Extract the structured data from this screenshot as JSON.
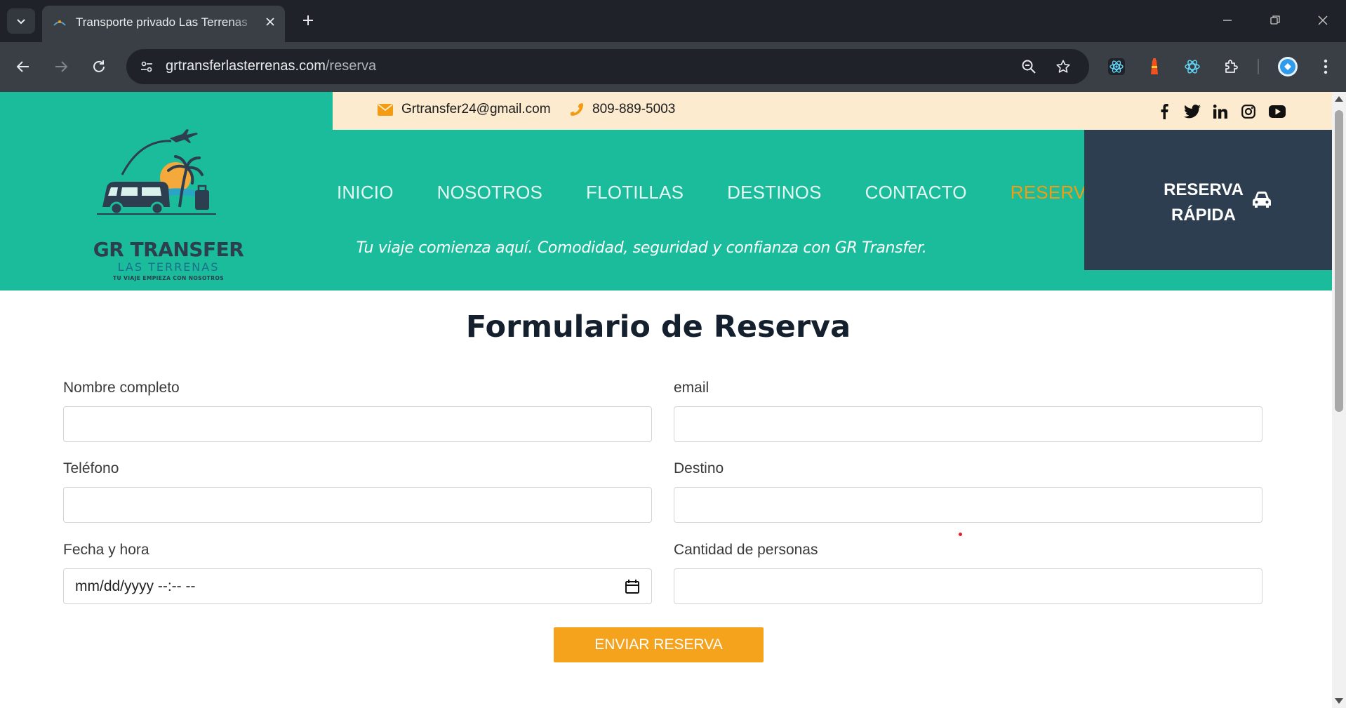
{
  "browser": {
    "tab_title": "Transporte privado Las Terrenas",
    "url_domain": "grtransferlasterrenas.com",
    "url_path": "/reserva"
  },
  "topbar": {
    "email": "Grtransfer24@gmail.com",
    "phone": "809-889-5003"
  },
  "logo": {
    "line1": "GR TRANSFER",
    "line2": "LAS TERRENAS",
    "line3": "TU VIAJE EMPIEZA CON NOSOTROS"
  },
  "nav": {
    "items": [
      {
        "label": "INICIO"
      },
      {
        "label": "NOSOTROS"
      },
      {
        "label": "FLOTILLAS"
      },
      {
        "label": "DESTINOS"
      },
      {
        "label": "CONTACTO"
      },
      {
        "label": "RESERVAR"
      }
    ]
  },
  "tagline": "Tu viaje comienza aquí. Comodidad, seguridad y confianza con GR Transfer.",
  "quick_reserve": {
    "line1": "RESERVA",
    "line2": "RÁPIDA"
  },
  "form": {
    "title": "Formulario de Reserva",
    "fields": {
      "name": {
        "label": "Nombre completo"
      },
      "email": {
        "label": "email"
      },
      "phone": {
        "label": "Teléfono"
      },
      "destination": {
        "label": "Destino"
      },
      "datetime": {
        "label": "Fecha y hora",
        "placeholder": "mm/dd/yyyy --:-- --"
      },
      "people": {
        "label": "Cantidad de personas"
      }
    },
    "submit_label": "ENVIAR RESERVA"
  },
  "colors": {
    "header_teal": "#1abc9c",
    "topbar_cream": "#fdebd0",
    "accent_orange": "#f39c12",
    "quick_navy": "#2c3e50",
    "button_orange": "#f5a21c"
  }
}
